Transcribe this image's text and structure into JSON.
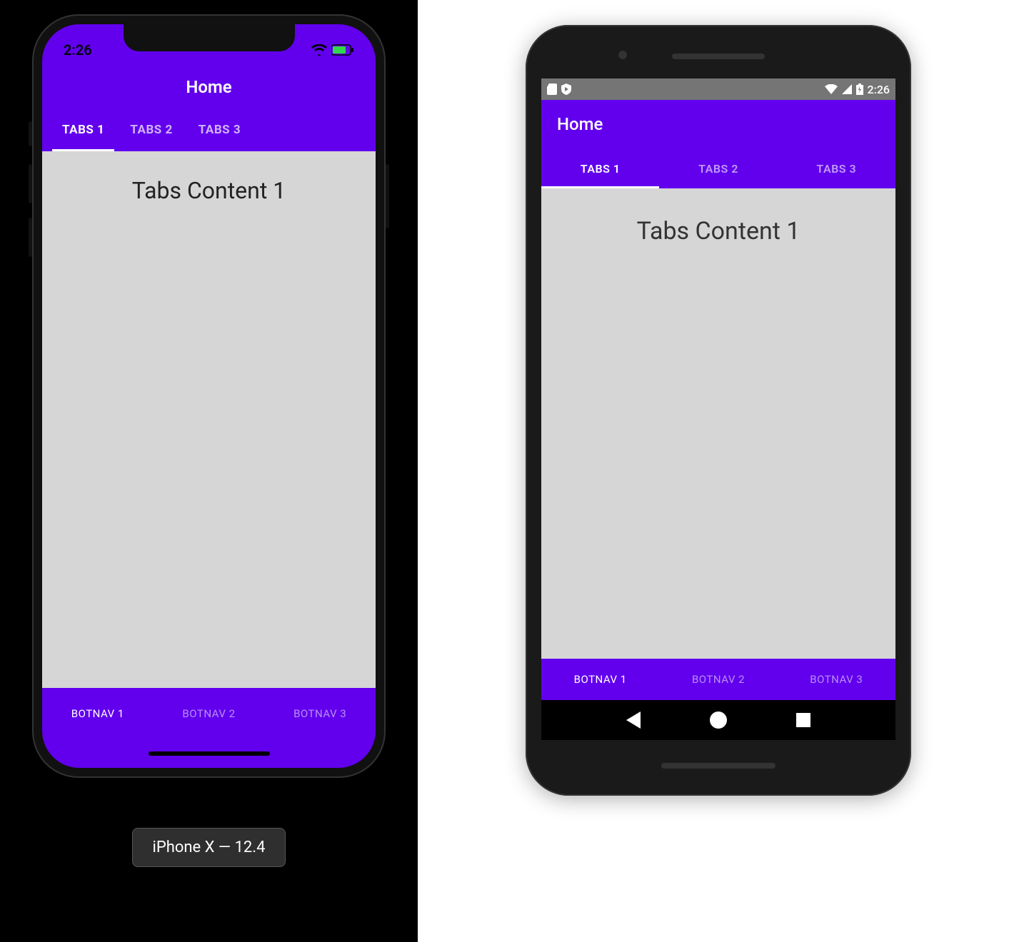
{
  "colors": {
    "primary": "#6200ee",
    "content_bg": "#d6d6d6"
  },
  "ios": {
    "status": {
      "time": "2:26"
    },
    "title": "Home",
    "tabs": [
      {
        "label": "TABS 1",
        "active": true
      },
      {
        "label": "TABS 2",
        "active": false
      },
      {
        "label": "TABS 3",
        "active": false
      }
    ],
    "content": "Tabs Content 1",
    "bottom_nav": [
      {
        "label": "BOTNAV 1",
        "active": true
      },
      {
        "label": "BOTNAV 2",
        "active": false
      },
      {
        "label": "BOTNAV 3",
        "active": false
      }
    ],
    "device_caption": "iPhone X — 12.4"
  },
  "android": {
    "status": {
      "time": "2:26"
    },
    "title": "Home",
    "tabs": [
      {
        "label": "TABS 1",
        "active": true
      },
      {
        "label": "TABS 2",
        "active": false
      },
      {
        "label": "TABS 3",
        "active": false
      }
    ],
    "content": "Tabs Content 1",
    "bottom_nav": [
      {
        "label": "BOTNAV 1",
        "active": true
      },
      {
        "label": "BOTNAV 2",
        "active": false
      },
      {
        "label": "BOTNAV 3",
        "active": false
      }
    ]
  }
}
